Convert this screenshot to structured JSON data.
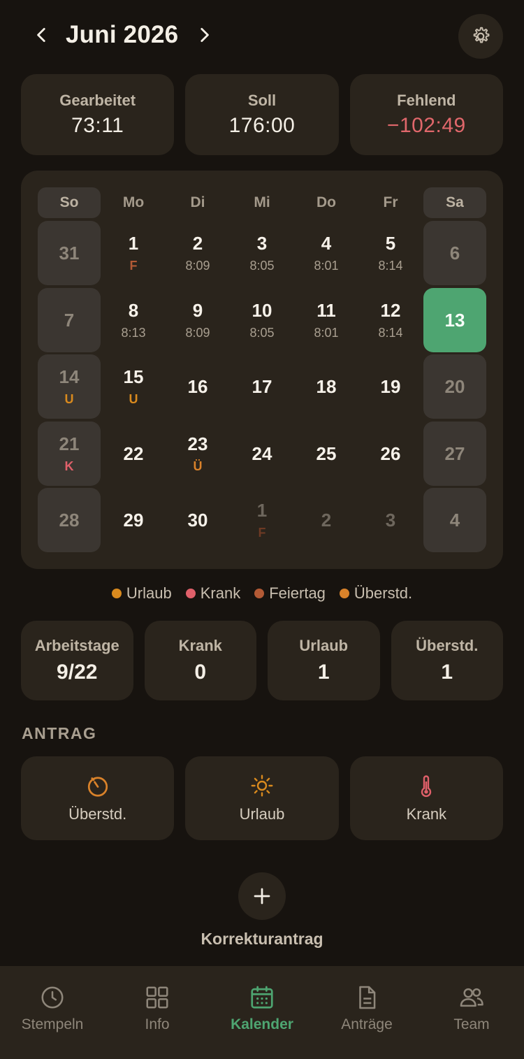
{
  "header": {
    "title": "Juni 2026"
  },
  "summary": {
    "worked_label": "Gearbeitet",
    "worked_value": "73:11",
    "target_label": "Soll",
    "target_value": "176:00",
    "missing_label": "Fehlend",
    "missing_value": "−102:49"
  },
  "calendar": {
    "weekdays": [
      "So",
      "Mo",
      "Di",
      "Mi",
      "Do",
      "Fr",
      "Sa"
    ],
    "weeks": [
      [
        {
          "num": "31",
          "sub": "",
          "type": "weekend"
        },
        {
          "num": "1",
          "sub": "F",
          "type": "day"
        },
        {
          "num": "2",
          "sub": "8:09",
          "type": "day"
        },
        {
          "num": "3",
          "sub": "8:05",
          "type": "day"
        },
        {
          "num": "4",
          "sub": "8:01",
          "type": "day"
        },
        {
          "num": "5",
          "sub": "8:14",
          "type": "day"
        },
        {
          "num": "6",
          "sub": "",
          "type": "weekend"
        }
      ],
      [
        {
          "num": "7",
          "sub": "",
          "type": "weekend"
        },
        {
          "num": "8",
          "sub": "8:13",
          "type": "day"
        },
        {
          "num": "9",
          "sub": "8:09",
          "type": "day"
        },
        {
          "num": "10",
          "sub": "8:05",
          "type": "day"
        },
        {
          "num": "11",
          "sub": "8:01",
          "type": "day"
        },
        {
          "num": "12",
          "sub": "8:14",
          "type": "day"
        },
        {
          "num": "13",
          "sub": "",
          "type": "today"
        }
      ],
      [
        {
          "num": "14",
          "sub": "U",
          "type": "weekend"
        },
        {
          "num": "15",
          "sub": "U",
          "type": "day"
        },
        {
          "num": "16",
          "sub": "",
          "type": "day"
        },
        {
          "num": "17",
          "sub": "",
          "type": "day"
        },
        {
          "num": "18",
          "sub": "",
          "type": "day"
        },
        {
          "num": "19",
          "sub": "",
          "type": "day"
        },
        {
          "num": "20",
          "sub": "",
          "type": "weekend"
        }
      ],
      [
        {
          "num": "21",
          "sub": "K",
          "type": "weekend"
        },
        {
          "num": "22",
          "sub": "",
          "type": "day"
        },
        {
          "num": "23",
          "sub": "Ü",
          "type": "day"
        },
        {
          "num": "24",
          "sub": "",
          "type": "day"
        },
        {
          "num": "25",
          "sub": "",
          "type": "day"
        },
        {
          "num": "26",
          "sub": "",
          "type": "day"
        },
        {
          "num": "27",
          "sub": "",
          "type": "weekend"
        }
      ],
      [
        {
          "num": "28",
          "sub": "",
          "type": "weekend"
        },
        {
          "num": "29",
          "sub": "",
          "type": "day"
        },
        {
          "num": "30",
          "sub": "",
          "type": "day"
        },
        {
          "num": "1",
          "sub": "F",
          "type": "other"
        },
        {
          "num": "2",
          "sub": "",
          "type": "other"
        },
        {
          "num": "3",
          "sub": "",
          "type": "other"
        },
        {
          "num": "4",
          "sub": "",
          "type": "weekend"
        }
      ]
    ]
  },
  "legend": [
    {
      "label": "Urlaub",
      "color": "#d98a1e"
    },
    {
      "label": "Krank",
      "color": "#e0606a"
    },
    {
      "label": "Feiertag",
      "color": "#b35a35"
    },
    {
      "label": "Überstd.",
      "color": "#d9822a"
    }
  ],
  "stats": {
    "workdays_label": "Arbeitstage",
    "workdays_value": "9/22",
    "sick_label": "Krank",
    "sick_value": "0",
    "vacation_label": "Urlaub",
    "vacation_value": "1",
    "overtime_label": "Überstd.",
    "overtime_value": "1"
  },
  "requests": {
    "heading": "ANTRAG",
    "overtime_label": "Überstd.",
    "vacation_label": "Urlaub",
    "sick_label": "Krank"
  },
  "correction": {
    "label": "Korrekturantrag"
  },
  "bottom_nav": {
    "stempeln": "Stempeln",
    "info": "Info",
    "kalender": "Kalender",
    "antraege": "Anträge",
    "team": "Team"
  },
  "colors": {
    "accent": "#4ea571",
    "negative": "#e0676b",
    "card": "#2a241c",
    "background": "#17130f"
  }
}
